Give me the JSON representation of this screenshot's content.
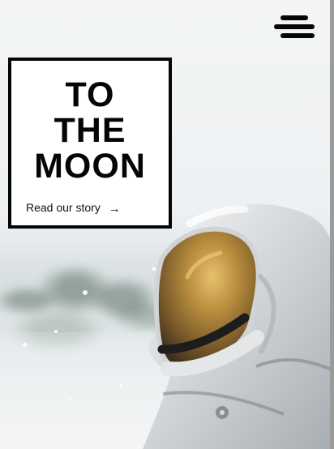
{
  "hero": {
    "title_lines": [
      "TO",
      "THE",
      "MOON"
    ],
    "link_text": "Read our story"
  },
  "icons": {
    "menu": "hamburger-menu-icon",
    "arrow": "arrow-right-icon"
  },
  "colors": {
    "text": "#050505",
    "card_background": "#ffffff",
    "sky": "#f2f4f5",
    "helmet_visor": "#b78a39",
    "suit": "#d7d9dc"
  }
}
